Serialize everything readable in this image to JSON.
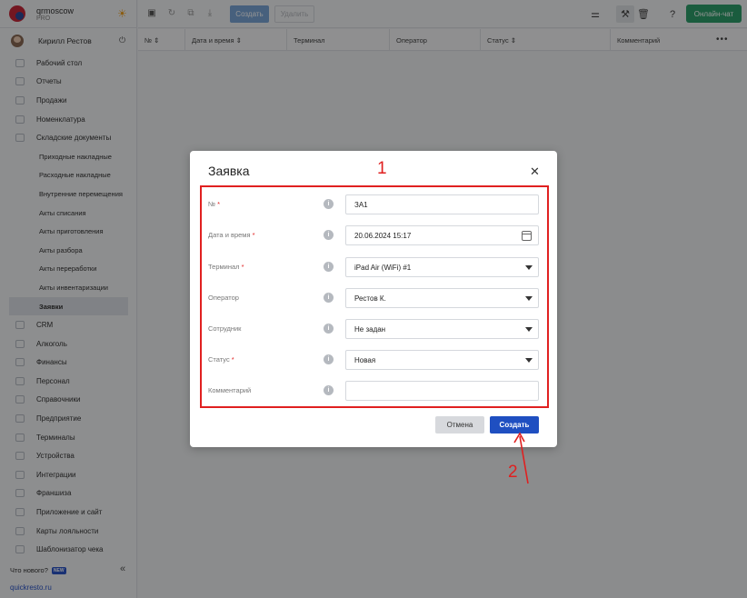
{
  "brand": {
    "name": "qrmoscow",
    "plan": "PRO"
  },
  "user": {
    "name": "Кирилл Рестов"
  },
  "sidebar": {
    "items": [
      {
        "label": "Рабочий стол",
        "icon": "dashboard-icon"
      },
      {
        "label": "Отчеты",
        "icon": "reports-icon"
      },
      {
        "label": "Продажи",
        "icon": "sales-icon"
      },
      {
        "label": "Номенклатура",
        "icon": "nomenclature-icon"
      },
      {
        "label": "Складские документы",
        "icon": "warehouse-docs-icon"
      }
    ],
    "subitems": [
      "Приходные накладные",
      "Расходные накладные",
      "Внутренние перемещения",
      "Акты списания",
      "Акты приготовления",
      "Акты разбора",
      "Акты переработки",
      "Акты инвентаризации",
      "Заявки"
    ],
    "active_subitem": "Заявки",
    "items_after": [
      {
        "label": "CRM",
        "icon": "crm-icon"
      },
      {
        "label": "Алкоголь",
        "icon": "alcohol-icon"
      },
      {
        "label": "Финансы",
        "icon": "finance-icon"
      },
      {
        "label": "Персонал",
        "icon": "staff-icon"
      },
      {
        "label": "Справочники",
        "icon": "reference-icon"
      },
      {
        "label": "Предприятие",
        "icon": "enterprise-icon"
      },
      {
        "label": "Терминалы",
        "icon": "terminals-icon"
      },
      {
        "label": "Устройства",
        "icon": "devices-icon"
      },
      {
        "label": "Интеграции",
        "icon": "integrations-icon"
      },
      {
        "label": "Франшиза",
        "icon": "franchise-icon"
      },
      {
        "label": "Приложение и сайт",
        "icon": "app-site-icon"
      },
      {
        "label": "Карты лояльности",
        "icon": "loyalty-icon"
      },
      {
        "label": "Шаблонизатор чека",
        "icon": "receipt-template-icon"
      }
    ],
    "whats_new": "Что нового?",
    "new_badge": "NEW",
    "site_link": "quickresto.ru"
  },
  "toolbar": {
    "create_label": "Создать",
    "delete_label": "Удалить",
    "chat_label": "Онлайн-чат"
  },
  "table": {
    "columns": [
      "№",
      "Дата и время",
      "Терминал",
      "Оператор",
      "Статус",
      "Комментарий"
    ]
  },
  "modal": {
    "title": "Заявка",
    "annotation_1": "1",
    "annotation_2": "2",
    "fields": [
      {
        "label": "№",
        "required": true,
        "value": "ЗА1",
        "type": "text"
      },
      {
        "label": "Дата и время",
        "required": true,
        "value": "20.06.2024 15:17",
        "type": "date"
      },
      {
        "label": "Терминал",
        "required": true,
        "value": "iPad Air (WiFi) #1",
        "type": "select"
      },
      {
        "label": "Оператор",
        "required": false,
        "value": "Рестов К.",
        "type": "select"
      },
      {
        "label": "Сотрудник",
        "required": false,
        "value": "Не задан",
        "type": "select"
      },
      {
        "label": "Статус",
        "required": true,
        "value": "Новая",
        "type": "select"
      },
      {
        "label": "Комментарий",
        "required": false,
        "value": "",
        "type": "text"
      }
    ],
    "cancel_label": "Отмена",
    "create_label": "Создать"
  },
  "colors": {
    "primary": "#1f4fc1",
    "chat": "#2e9f6c",
    "annotation": "#e02020"
  }
}
